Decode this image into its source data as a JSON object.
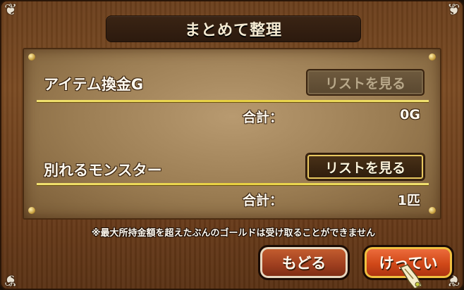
{
  "dialog": {
    "title": "まとめて整理"
  },
  "sections": [
    {
      "label": "アイテム換金G",
      "button_label": "リストを見る",
      "button_enabled": false,
      "total_label": "合計：",
      "total_value": "0G"
    },
    {
      "label": "別れるモンスター",
      "button_label": "リストを見る",
      "button_enabled": true,
      "total_label": "合計：",
      "total_value": "1匹"
    }
  ],
  "notice": "※最大所持金額を超えたぶんのゴールドは受け取ることができません",
  "buttons": {
    "back": "もどる",
    "confirm": "けってい"
  },
  "colors": {
    "wood": "#6b3f1c",
    "parchment": "#b89a70",
    "divider": "#e8d040",
    "back_button": "#a04020",
    "confirm_button": "#d04818",
    "confirm_border": "#f0c040"
  },
  "icons": [
    "corner-ornament-icon",
    "rivet-icon",
    "pointer-hand-icon"
  ]
}
